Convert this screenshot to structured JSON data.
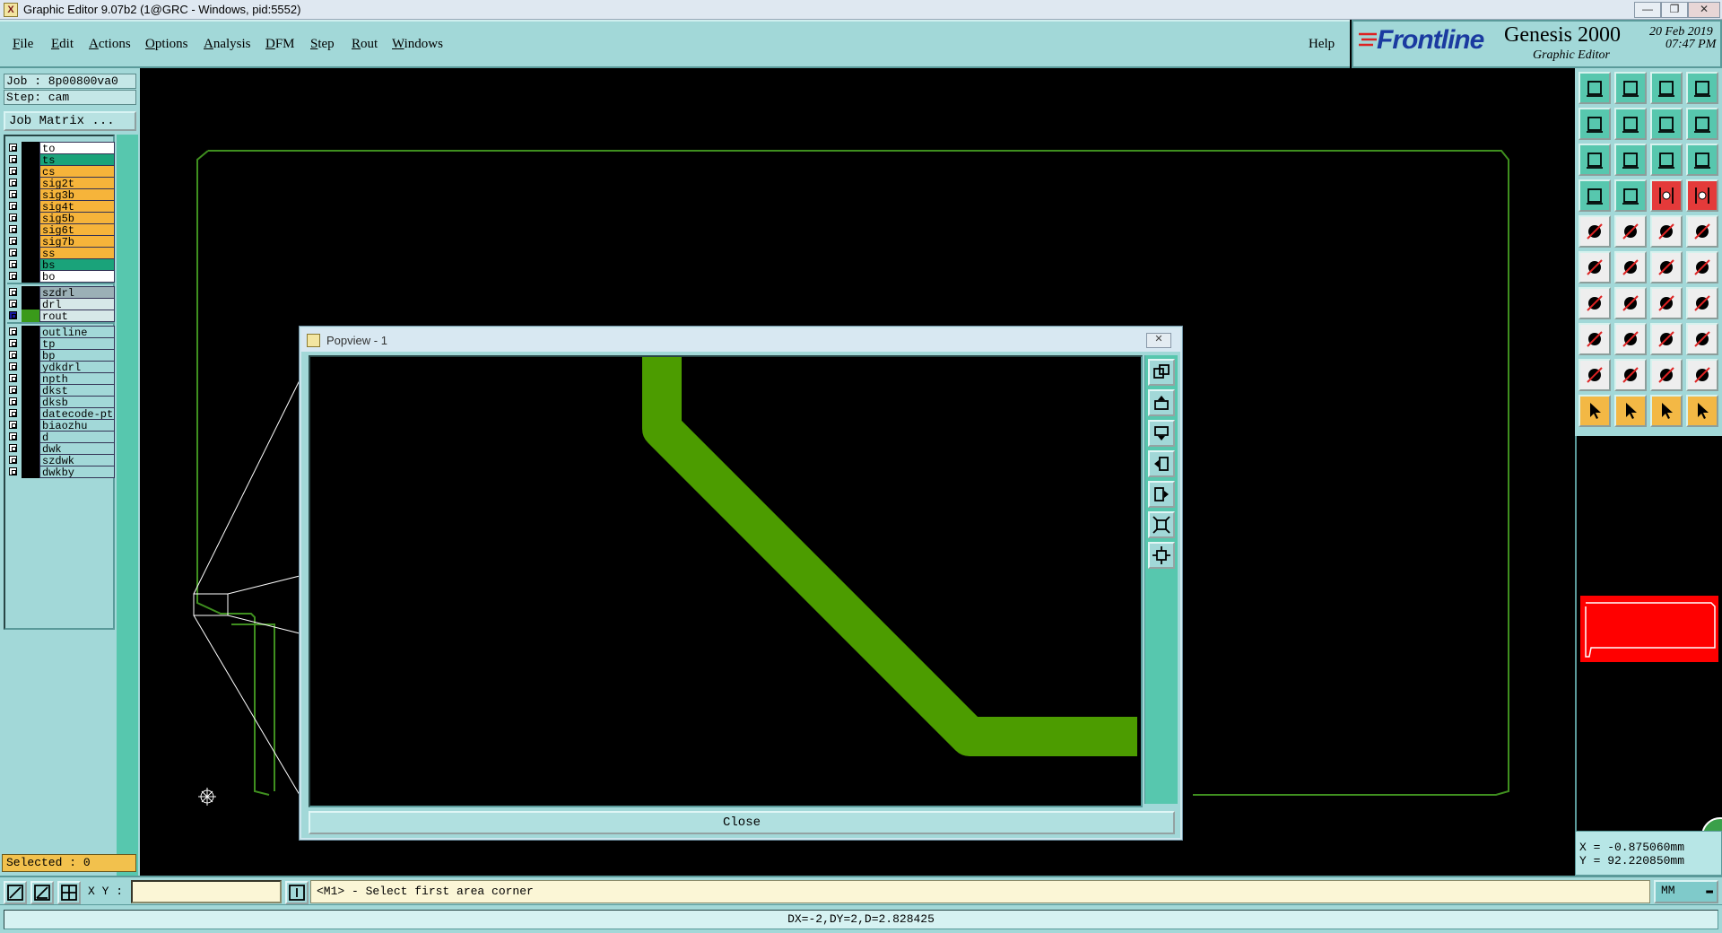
{
  "window": {
    "title": "Graphic Editor 9.07b2 (1@GRC - Windows, pid:5552)",
    "minimize": "—",
    "maximize": "❐",
    "close": "✕"
  },
  "menu": {
    "items": [
      {
        "key": "F",
        "rest": "ile"
      },
      {
        "key": "E",
        "rest": "dit"
      },
      {
        "key": "A",
        "rest": "ctions"
      },
      {
        "key": "O",
        "rest": "ptions"
      },
      {
        "key": "A",
        "rest": "nalysis"
      },
      {
        "key": "D",
        "rest": "FM"
      },
      {
        "key": "S",
        "rest": "tep"
      },
      {
        "key": "R",
        "rest": "out"
      },
      {
        "key": "W",
        "rest": "indows"
      }
    ],
    "help": "Help"
  },
  "brand": {
    "logo": "Frontline",
    "product": "Genesis 2000",
    "subtitle": "Graphic Editor",
    "date": "20 Feb 2019",
    "time": "07:47 PM"
  },
  "job": {
    "job_line": "Job : 8p00800va0",
    "step_line": "Step: cam",
    "matrix_button": "Job Matrix ..."
  },
  "layers": {
    "group1": [
      {
        "name": "to",
        "color": "#ffffff"
      },
      {
        "name": "ts",
        "color": "#1aa37a"
      },
      {
        "name": "cs",
        "color": "#f6b43a"
      },
      {
        "name": "sig2t",
        "color": "#f6b43a"
      },
      {
        "name": "sig3b",
        "color": "#f6b43a"
      },
      {
        "name": "sig4t",
        "color": "#f6b43a"
      },
      {
        "name": "sig5b",
        "color": "#f6b43a"
      },
      {
        "name": "sig6t",
        "color": "#f6b43a"
      },
      {
        "name": "sig7b",
        "color": "#f6b43a"
      },
      {
        "name": "ss",
        "color": "#f6b43a"
      },
      {
        "name": "bs",
        "color": "#1aa37a"
      },
      {
        "name": "bo",
        "color": "#ffffff"
      }
    ],
    "group2": [
      {
        "name": "szdrl",
        "color": "#9bb0b6"
      },
      {
        "name": "drl",
        "color": "#d6e8e8"
      },
      {
        "name": "rout",
        "color": "#d6e8e8",
        "selected": true
      }
    ],
    "group3": [
      {
        "name": "outline",
        "color": "#a2d8d8"
      },
      {
        "name": "tp",
        "color": "#a2d8d8"
      },
      {
        "name": "bp",
        "color": "#a2d8d8"
      },
      {
        "name": "ydkdrl",
        "color": "#a2d8d8"
      },
      {
        "name": "npth",
        "color": "#a2d8d8"
      },
      {
        "name": "dkst",
        "color": "#a2d8d8"
      },
      {
        "name": "dksb",
        "color": "#a2d8d8"
      },
      {
        "name": "datecode-ptc",
        "color": "#a2d8d8"
      },
      {
        "name": "biaozhu",
        "color": "#a2d8d8"
      },
      {
        "name": "d",
        "color": "#a2d8d8"
      },
      {
        "name": "dwk",
        "color": "#a2d8d8"
      },
      {
        "name": "szdwk",
        "color": "#a2d8d8"
      },
      {
        "name": "dwkby",
        "color": "#a2d8d8"
      }
    ],
    "selected_text": "Selected : 0"
  },
  "toolbar": {
    "tools": [
      "zoom-home-icon",
      "zoom-home-icon",
      "home-icon",
      "window-split-icon",
      "pan-left-icon",
      "pan-right-icon",
      "undo-view-icon",
      "redo-view-icon",
      "zoom-fit-icon",
      "zoom-center-icon",
      "scale-1-2-icon",
      "help-icon",
      "snap-icon",
      "measure-icon",
      "layer-feature-icon",
      "layer-filter-icon",
      "camera-icon",
      "select-rect-icon",
      "ruler-icon",
      "pad-icon",
      "nodes-icon",
      "cross-icon",
      "connect-icon",
      "connect-2-icon",
      "line-icon",
      "line-2-icon",
      "arc-icon",
      "align-icon",
      "shape-icon",
      "minus-icon",
      "slot-icon",
      "pads-icon",
      "angle-icon",
      "text-a-icon",
      "text-a-2-icon",
      "text-a-3-icon",
      "pointer-icon",
      "pointer-2-icon",
      "pointer-3-icon",
      "route-icon"
    ],
    "styles": [
      "teal",
      "teal",
      "teal",
      "teal",
      "teal",
      "teal",
      "teal",
      "teal",
      "teal",
      "teal",
      "teal",
      "teal",
      "teal",
      "teal",
      "red",
      "red",
      "white",
      "white",
      "white",
      "white",
      "white",
      "white",
      "white",
      "white",
      "white",
      "white",
      "white",
      "white",
      "white",
      "white",
      "white",
      "white",
      "white",
      "white",
      "white",
      "white",
      "orange",
      "orange",
      "orange",
      "orange"
    ]
  },
  "coords": {
    "x_line": "X = -0.875060mm",
    "y_line": "Y = 92.220850mm"
  },
  "popview": {
    "title": "Popview - 1",
    "close_x": "✕",
    "close_button": "Close",
    "trace_color": "#4c9c00"
  },
  "bottom": {
    "xy_label": "X Y :",
    "xy_value": "",
    "prompt": "<M1> - Select first area corner",
    "units": "MM",
    "status": "DX=-2,DY=2,D=2.828425"
  },
  "colors": {
    "outline": "#3f8f1f",
    "panel": "#a2d8d8",
    "minimap_red": "#ff0000"
  }
}
